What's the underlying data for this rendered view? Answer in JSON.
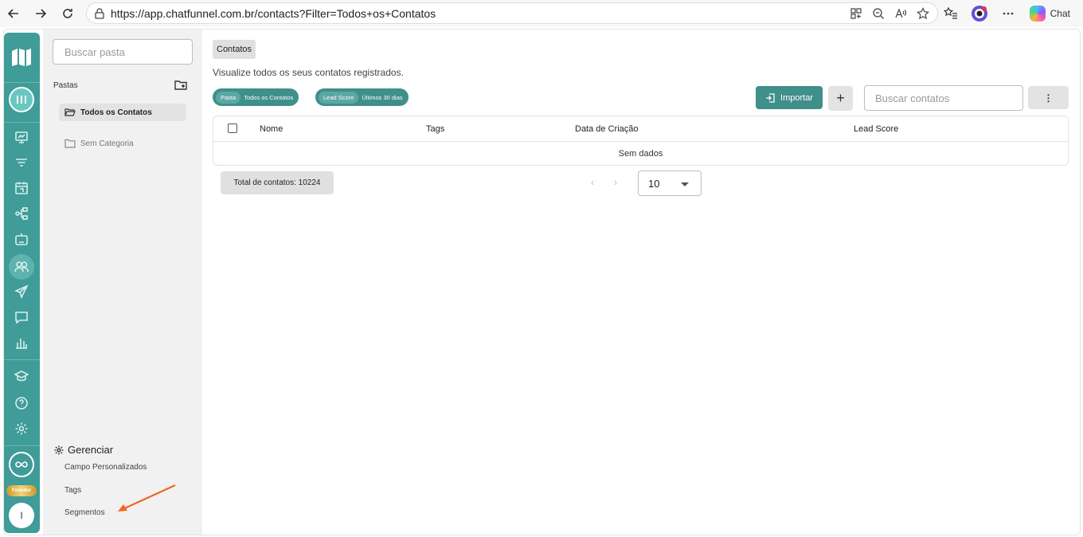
{
  "browser": {
    "url": "https://app.chatfunnel.com.br/contacts?Filter=Todos+os+Contatos",
    "chat_label": "Chat"
  },
  "rail": {
    "founder_badge": "Founder",
    "user_initial": "I"
  },
  "folders": {
    "search_placeholder": "Buscar pasta",
    "section_label": "Pastas",
    "items": [
      {
        "label": "Todos os Contatos",
        "active": true
      },
      {
        "label": "Sem Categoria",
        "active": false
      }
    ],
    "manage_title": "Gerenciar",
    "manage_links": [
      "Campo Personalizados",
      "Tags",
      "Segmentos"
    ]
  },
  "main": {
    "page_title": "Contatos",
    "subtitle": "Visualize todos os seus contatos registrados.",
    "filters": [
      {
        "key": "Pasta",
        "value": "Todos os Contatos"
      },
      {
        "key": "Lead Score",
        "value": "Últimos 30 dias"
      }
    ],
    "import_label": "Importar",
    "add_label": "+",
    "search_placeholder": "Buscar contatos",
    "more_label": "⋮",
    "columns": [
      "Nome",
      "Tags",
      "Data de Criação",
      "Lead Score"
    ],
    "empty_text": "Sem dados",
    "total_text": "Total de contatos: 10224",
    "page_size": "10"
  },
  "colors": {
    "accent": "#3f8f8b",
    "rail": "#3f9c98",
    "annotation_arrow": "#f26522"
  }
}
